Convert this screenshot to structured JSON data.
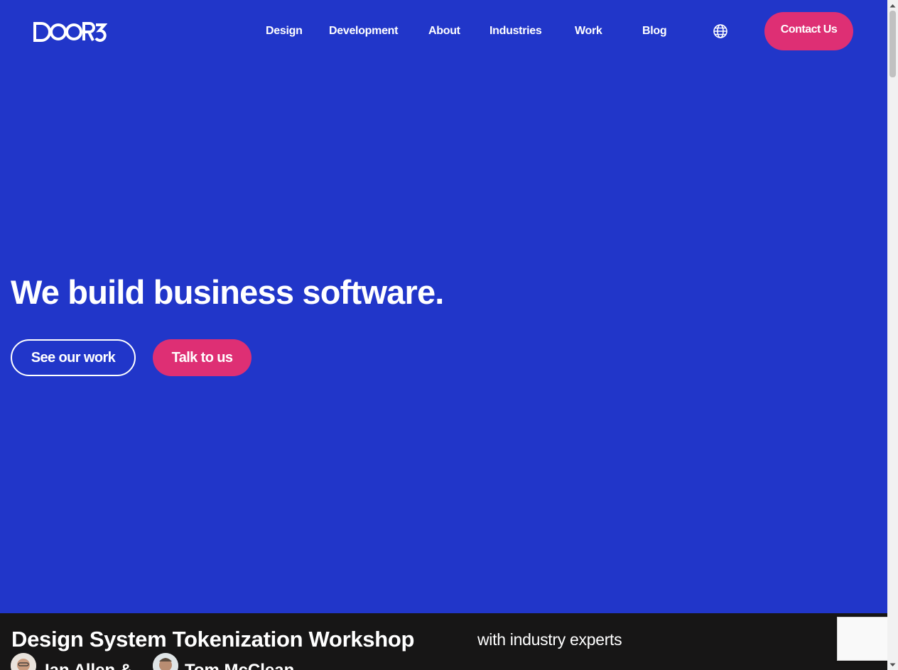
{
  "header": {
    "logo_text": "DOOR3",
    "nav": [
      {
        "label": "Design"
      },
      {
        "label": "Development"
      },
      {
        "label": "About"
      },
      {
        "label": "Industries"
      },
      {
        "label": "Work"
      },
      {
        "label": "Blog"
      }
    ],
    "language_icon": "globe-icon",
    "contact_label": "Contact Us"
  },
  "hero": {
    "title": "We build business software.",
    "primary_cta": "See our work",
    "secondary_cta": "Talk to us"
  },
  "banner": {
    "title": "Design System Tokenization Workshop",
    "subtitle": "with industry experts",
    "speakers": [
      {
        "name": "Ian Allen &"
      },
      {
        "name": "Tom McClean"
      }
    ]
  },
  "colors": {
    "background": "#2136c9",
    "accent": "#de2f74",
    "banner": "#171616",
    "text": "#ffffff"
  }
}
